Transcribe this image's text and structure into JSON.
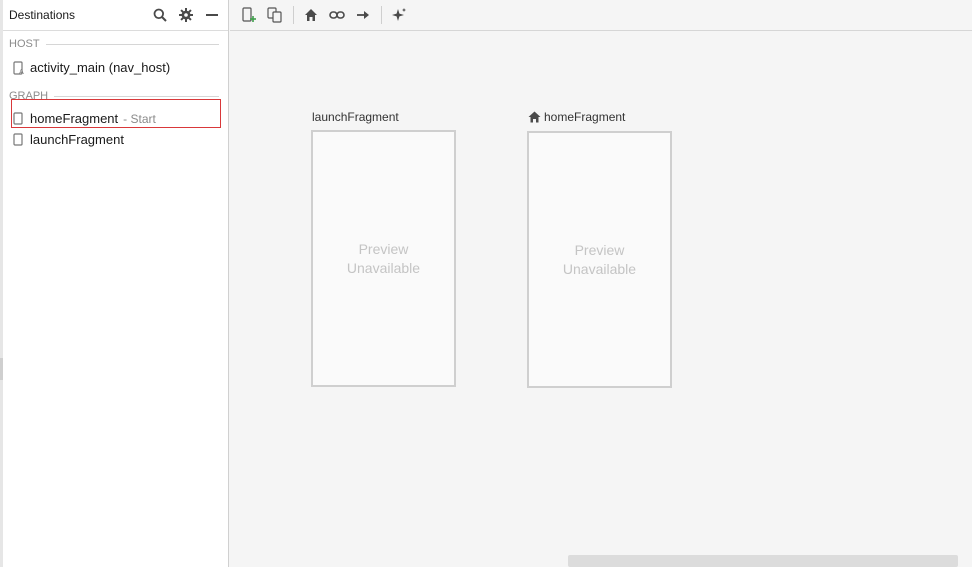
{
  "panel": {
    "title": "Destinations",
    "host_section": "HOST",
    "host_item": "activity_main (nav_host)",
    "graph_section": "GRAPH",
    "graph_items": [
      {
        "label": "homeFragment",
        "suffix": "- Start"
      },
      {
        "label": "launchFragment",
        "suffix": ""
      }
    ]
  },
  "toolbar": {
    "icons": [
      "new-destination-icon",
      "nested-graph-icon",
      "assign-start-icon",
      "deep-link-icon",
      "add-action-icon",
      "auto-arrange-icon"
    ]
  },
  "canvas": {
    "fragments": [
      {
        "label": "launchFragment",
        "start": false,
        "preview_line1": "Preview",
        "preview_line2": "Unavailable"
      },
      {
        "label": "homeFragment",
        "start": true,
        "preview_line1": "Preview",
        "preview_line2": "Unavailable"
      }
    ]
  },
  "colors": {
    "selection": "#d9383a",
    "accent_green": "#3e9e4a",
    "card_border": "#cfcfcf",
    "preview_text": "#c4c4c4"
  }
}
